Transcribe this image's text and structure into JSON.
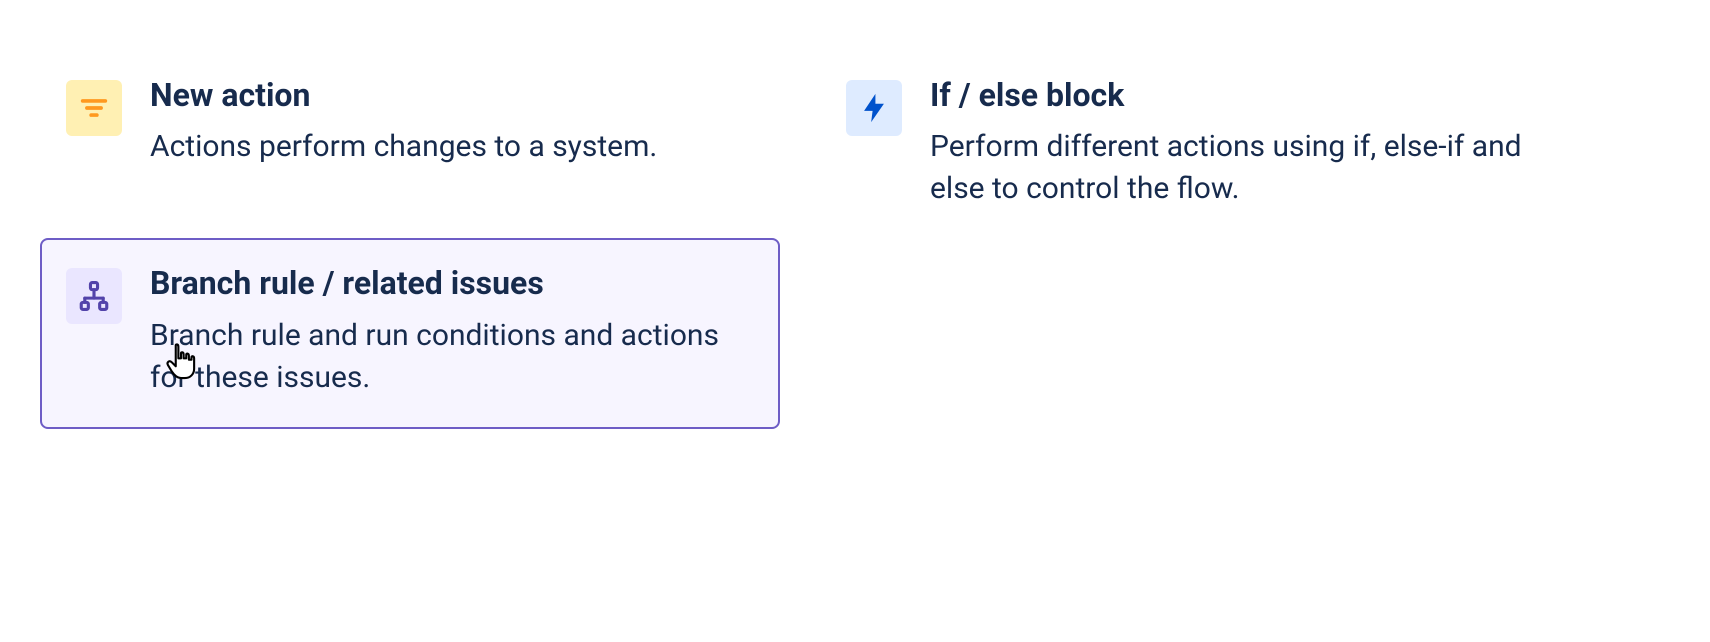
{
  "cards": {
    "new_action": {
      "title": "New action",
      "desc": "Actions perform changes to a system."
    },
    "if_else": {
      "title": "If / else block",
      "desc": "Perform different actions using if, else-if and else to control the flow."
    },
    "branch": {
      "title": "Branch rule / related issues",
      "desc": "Branch rule and run conditions and actions for these issues."
    }
  },
  "colors": {
    "icon_yellow_bg": "#FFF0B3",
    "icon_blue_bg": "#DEEBFF",
    "icon_purple_bg": "#EAE6FF",
    "accent_yellow": "#FF991F",
    "accent_blue": "#0052CC",
    "accent_purple": "#5243AA",
    "selected_border": "#6E5DC6",
    "selected_bg": "#F7F5FF",
    "text": "#172B4D"
  }
}
